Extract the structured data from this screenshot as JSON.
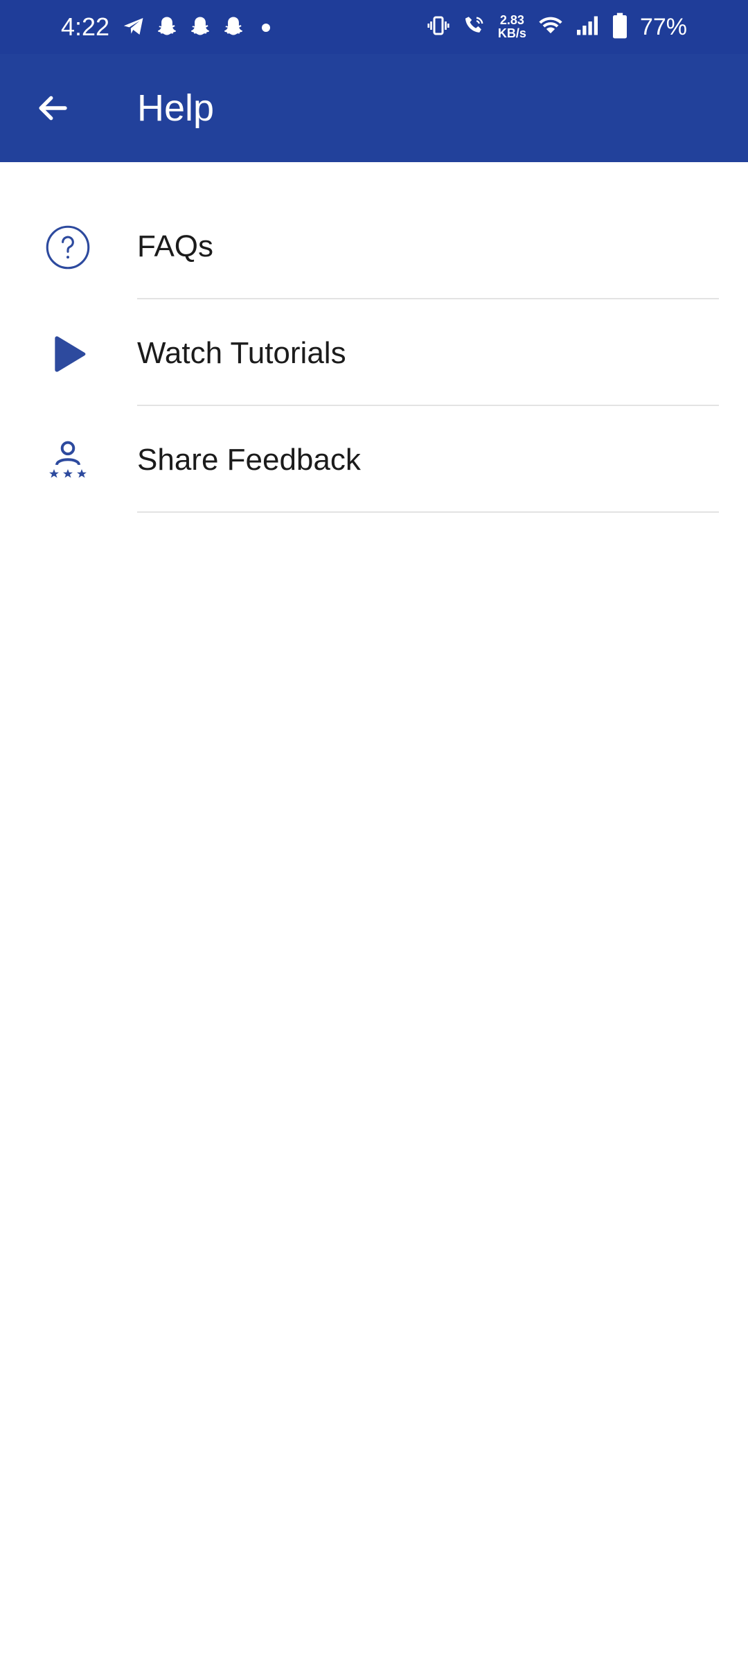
{
  "status_bar": {
    "time": "4:22",
    "net_speed_value": "2.83",
    "net_speed_unit": "KB/s",
    "battery_percent": "77%",
    "icons": [
      "telegram-icon",
      "snapchat-icon",
      "snapchat-icon",
      "snapchat-icon",
      "more-dot-icon",
      "vibrate-icon",
      "wifi-call-icon",
      "wifi-icon",
      "signal-icon",
      "battery-icon"
    ]
  },
  "app_bar": {
    "title": "Help",
    "back_icon": "arrow-left-icon"
  },
  "menu": {
    "items": [
      {
        "label": "FAQs",
        "icon": "question-circle-icon"
      },
      {
        "label": "Watch Tutorials",
        "icon": "play-icon"
      },
      {
        "label": "Share Feedback",
        "icon": "user-rating-icon"
      }
    ]
  },
  "colors": {
    "status_bar_bg": "#1f3d99",
    "app_bar_bg": "#22419b",
    "icon_color": "#2d4a9e",
    "divider": "#e3e3e3",
    "text": "#1b1b1b"
  }
}
